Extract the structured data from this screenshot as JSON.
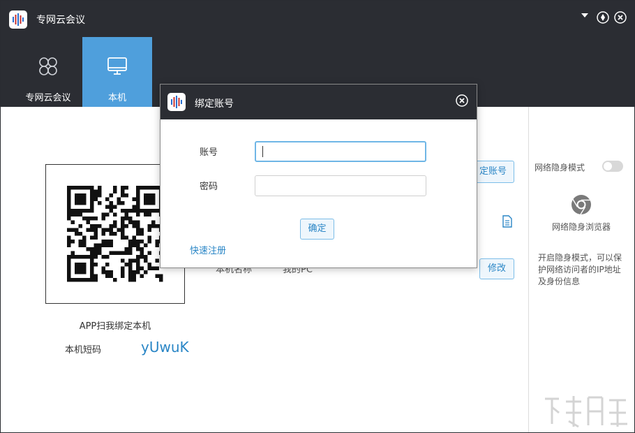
{
  "app": {
    "title": "专网云会议"
  },
  "nav": {
    "tabs": [
      {
        "label": "专网云会议",
        "active": false
      },
      {
        "label": "本机",
        "active": true
      }
    ]
  },
  "main": {
    "qr_caption": "APP扫我绑定本机",
    "short_code_label": "本机短码",
    "short_code_value": "yUwuK",
    "bind_button": "定账号",
    "pc_name_label": "本机名称",
    "pc_name_value": "我的PC",
    "modify_button": "修改"
  },
  "side": {
    "incognito_mode_label": "网络隐身模式",
    "incognito_enabled": false,
    "browser_label": "网络隐身浏览器",
    "description": "开启隐身模式，可以保护网络访问者的IP地址及身份信息"
  },
  "modal": {
    "title": "绑定账号",
    "account_label": "账号",
    "account_value": "",
    "password_label": "密码",
    "password_value": "",
    "confirm_button": "确定",
    "quick_register": "快速注册"
  },
  "colors": {
    "header_bg": "#2b2d33",
    "active_tab": "#4f9fdc",
    "accent": "#2a86c6"
  }
}
